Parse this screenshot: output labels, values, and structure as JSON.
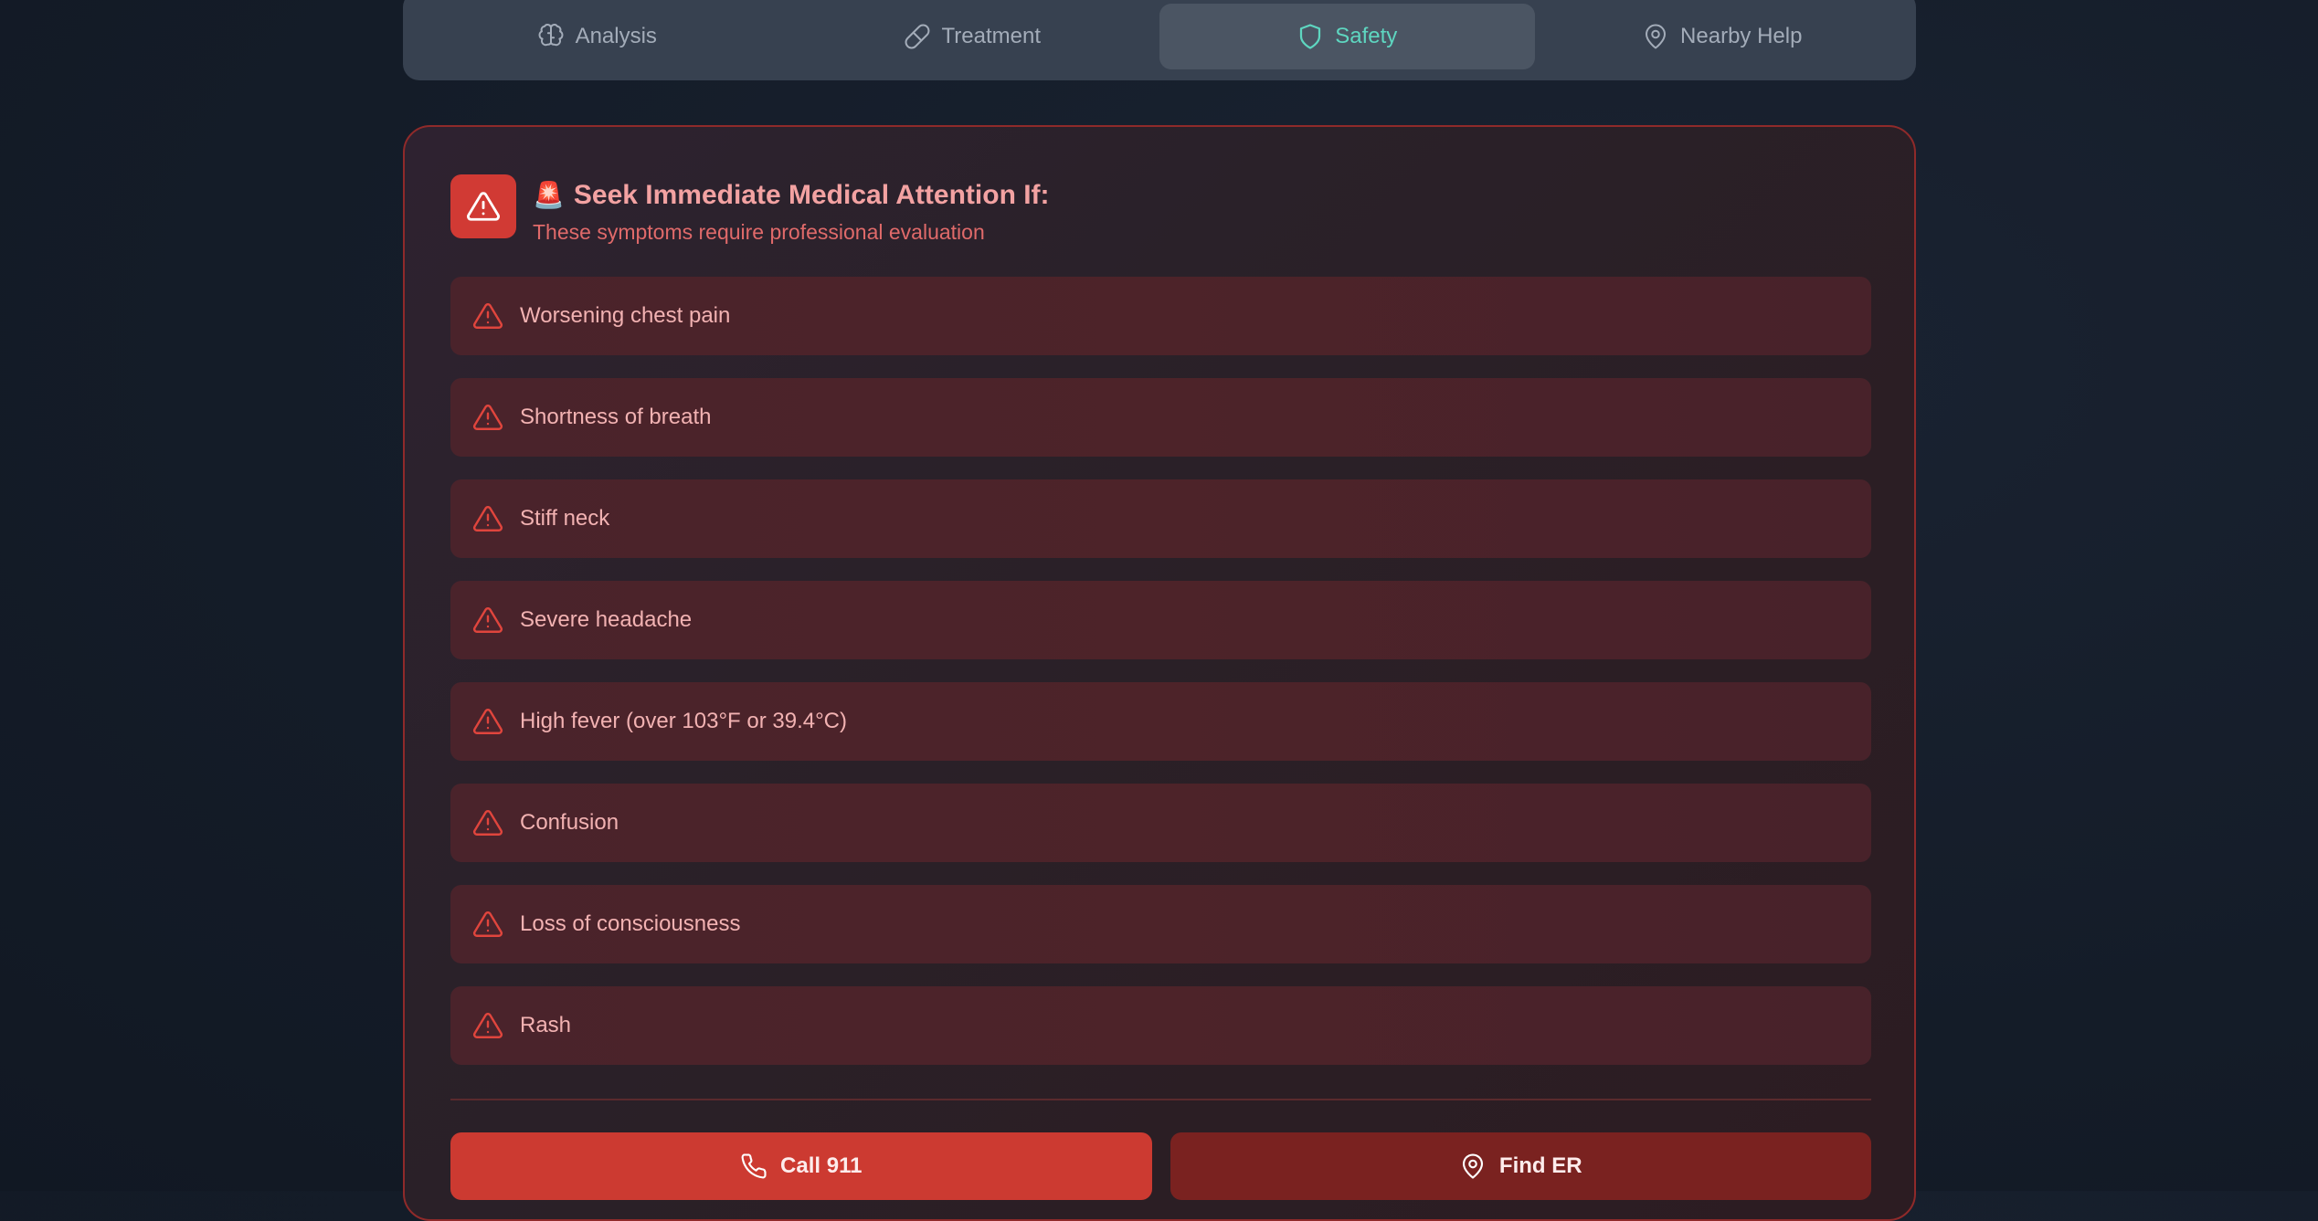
{
  "tabs": [
    {
      "label": "Analysis",
      "icon": "brain-icon",
      "active": false
    },
    {
      "label": "Treatment",
      "icon": "pill-icon",
      "active": false
    },
    {
      "label": "Safety",
      "icon": "shield-icon",
      "active": true
    },
    {
      "label": "Nearby Help",
      "icon": "map-pin-icon",
      "active": false
    }
  ],
  "alert": {
    "icon": "warning-triangle-icon",
    "emoji": "🚨",
    "title": "Seek Immediate Medical Attention If:",
    "subtitle": "These symptoms require professional evaluation",
    "symptoms": [
      "Worsening chest pain",
      "Shortness of breath",
      "Stiff neck",
      "Severe headache",
      "High fever (over 103°F or 39.4°C)",
      "Confusion",
      "Loss of consciousness",
      "Rash"
    ],
    "actions": {
      "call_label": "Call 911",
      "call_icon": "phone-icon",
      "find_label": "Find ER",
      "find_icon": "map-pin-icon"
    }
  },
  "colors": {
    "accent_active_tab": "#5ed6c0",
    "danger": "#d13a34",
    "danger_dark": "#7a2220"
  }
}
